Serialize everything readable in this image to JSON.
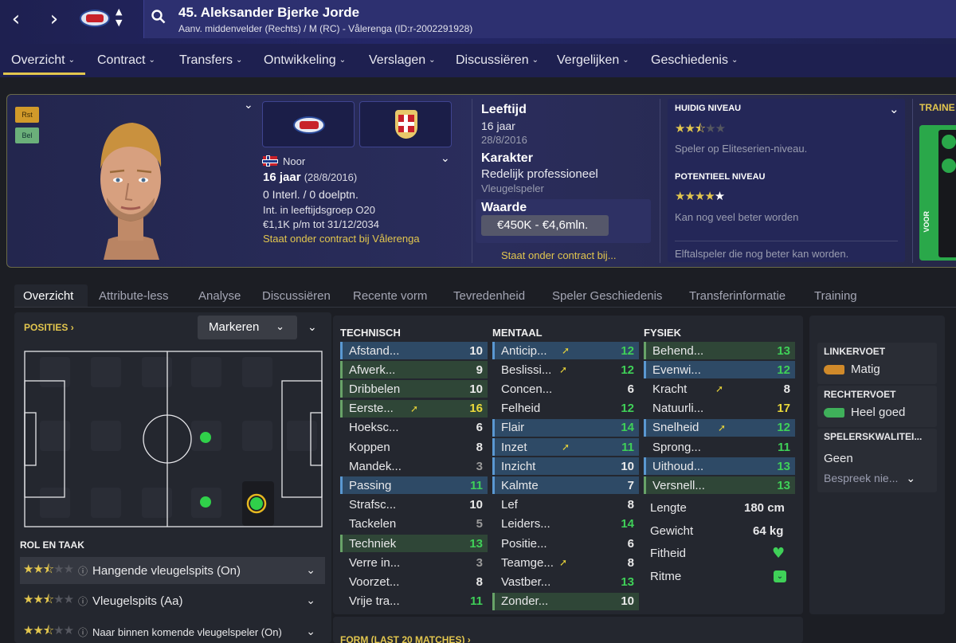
{
  "header": {
    "title": "45. Aleksander Bjerke Jorde",
    "subtitle": "Aanv. middenvelder (Rechts) / M (RC) - Vålerenga (ID:r-2002291928)"
  },
  "menu": [
    "Overzicht",
    "Contract",
    "Transfers",
    "Ontwikkeling",
    "Verslagen",
    "Discussiëren",
    "Vergelijken",
    "Geschiedenis"
  ],
  "badges": [
    "Rst",
    "Bel"
  ],
  "profile": {
    "nationality": "Noor",
    "age": "16 jaar",
    "dob": "(28/8/2016)",
    "caps": "0 Interl. / 0 doelptn.",
    "youth": "Int. in leeftijdsgroep O20",
    "wage": "€1,1K p/m tot 31/12/2034",
    "contract": "Staat onder contract bij Vålerenga"
  },
  "info": {
    "age_label": "Leeftijd",
    "age_value": "16 jaar",
    "dob": "28/8/2016",
    "char_label": "Karakter",
    "char_value": "Redelijk professioneel",
    "char_sub": "Vleugelspeler",
    "value_label": "Waarde",
    "value": "€450K - €4,6mln.",
    "contract_short": "Staat onder contract bij..."
  },
  "ability": {
    "current_label": "HUIDIG NIVEAU",
    "current_stars": 2.5,
    "current_text": "Speler op Eliteserien-niveau.",
    "potential_label": "POTENTIEEL NIVEAU",
    "potential_stars": 5,
    "potential_text": "Kan nog veel beter worden",
    "footer": "Elftalspeler die nog beter kan worden."
  },
  "trainer": {
    "label": "TRAINE",
    "side": "VOOR"
  },
  "tabs": [
    "Overzicht",
    "Attribute-less",
    "Analyse",
    "Discussiëren",
    "Recente vorm",
    "Tevredenheid",
    "Speler Geschiedenis",
    "Transferinformatie",
    "Training"
  ],
  "positions": {
    "label": "POSITIES",
    "button": "Markeren"
  },
  "role": {
    "label": "ROL EN TAAK",
    "items": [
      {
        "name": "Hangende vleugelspits (On)",
        "stars": 2.5
      },
      {
        "name": "Vleugelspits (Aa)",
        "stars": 2.5
      },
      {
        "name": "Naar binnen komende vleugelspeler (On)",
        "stars": 2.5
      }
    ]
  },
  "headers": {
    "tech": "TECHNISCH",
    "ment": "MENTAAL",
    "fys": "FYSIEK"
  },
  "technical": [
    {
      "n": "Afstand...",
      "v": "10",
      "h": "hl",
      "c": "c-w"
    },
    {
      "n": "Afwerk...",
      "v": "9",
      "h": "hg",
      "c": "c-w"
    },
    {
      "n": "Dribbelen",
      "v": "10",
      "h": "hg",
      "c": "c-w"
    },
    {
      "n": "Eerste...",
      "v": "16",
      "h": "hg",
      "c": "c-y",
      "a": true
    },
    {
      "n": "Hoeksc...",
      "v": "6",
      "h": "",
      "c": "c-w"
    },
    {
      "n": "Koppen",
      "v": "8",
      "h": "",
      "c": "c-w"
    },
    {
      "n": "Mandek...",
      "v": "3",
      "h": "",
      "c": "c-d"
    },
    {
      "n": "Passing",
      "v": "11",
      "h": "hl",
      "c": "c-g"
    },
    {
      "n": "Strafsc...",
      "v": "10",
      "h": "",
      "c": "c-w"
    },
    {
      "n": "Tackelen",
      "v": "5",
      "h": "",
      "c": "c-d"
    },
    {
      "n": "Techniek",
      "v": "13",
      "h": "hg",
      "c": "c-g"
    },
    {
      "n": "Verre in...",
      "v": "3",
      "h": "",
      "c": "c-d"
    },
    {
      "n": "Voorzet...",
      "v": "8",
      "h": "",
      "c": "c-w"
    },
    {
      "n": "Vrije tra...",
      "v": "11",
      "h": "",
      "c": "c-g"
    }
  ],
  "mental": [
    {
      "n": "Anticip...",
      "v": "12",
      "h": "hl",
      "c": "c-g",
      "a": true
    },
    {
      "n": "Beslissi...",
      "v": "12",
      "h": "",
      "c": "c-g",
      "a": true
    },
    {
      "n": "Concen...",
      "v": "6",
      "h": "",
      "c": "c-w"
    },
    {
      "n": "Felheid",
      "v": "12",
      "h": "",
      "c": "c-g"
    },
    {
      "n": "Flair",
      "v": "14",
      "h": "hl",
      "c": "c-g"
    },
    {
      "n": "Inzet",
      "v": "11",
      "h": "hl",
      "c": "c-g",
      "a": true
    },
    {
      "n": "Inzicht",
      "v": "10",
      "h": "hl",
      "c": "c-w"
    },
    {
      "n": "Kalmte",
      "v": "7",
      "h": "hl",
      "c": "c-w"
    },
    {
      "n": "Lef",
      "v": "8",
      "h": "",
      "c": "c-w"
    },
    {
      "n": "Leiders...",
      "v": "14",
      "h": "",
      "c": "c-g"
    },
    {
      "n": "Positie...",
      "v": "6",
      "h": "",
      "c": "c-w"
    },
    {
      "n": "Teamge...",
      "v": "8",
      "h": "",
      "c": "c-w",
      "a": true
    },
    {
      "n": "Vastber...",
      "v": "13",
      "h": "",
      "c": "c-g"
    },
    {
      "n": "Zonder...",
      "v": "10",
      "h": "hg",
      "c": "c-w"
    }
  ],
  "physical": [
    {
      "n": "Behend...",
      "v": "13",
      "h": "hg",
      "c": "c-g"
    },
    {
      "n": "Evenwi...",
      "v": "12",
      "h": "hl",
      "c": "c-g"
    },
    {
      "n": "Kracht",
      "v": "8",
      "h": "",
      "c": "c-w",
      "a": true
    },
    {
      "n": "Natuurli...",
      "v": "17",
      "h": "",
      "c": "c-y"
    },
    {
      "n": "Snelheid",
      "v": "12",
      "h": "hl",
      "c": "c-g",
      "a": true
    },
    {
      "n": "Sprong...",
      "v": "11",
      "h": "",
      "c": "c-g"
    },
    {
      "n": "Uithoud...",
      "v": "13",
      "h": "hl",
      "c": "c-g"
    },
    {
      "n": "Versnell...",
      "v": "13",
      "h": "hg",
      "c": "c-g"
    }
  ],
  "body": {
    "length_label": "Lengte",
    "length": "180 cm",
    "weight_label": "Gewicht",
    "weight": "64 kg",
    "fitness_label": "Fitheid",
    "rhythm_label": "Ritme"
  },
  "feet": {
    "left_label": "LINKERVOET",
    "left": "Matig",
    "right_label": "RECHTERVOET",
    "right": "Heel goed",
    "traits_label": "SPELERSKWALITEI...",
    "traits_value": "Geen",
    "discuss": "Bespreek nie..."
  },
  "form_label": "FORM (LAST 20 MATCHES)"
}
